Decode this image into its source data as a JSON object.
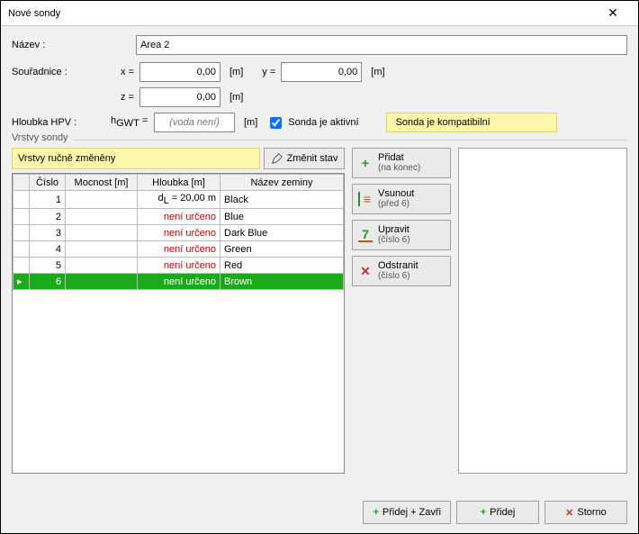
{
  "window": {
    "title": "Nové sondy"
  },
  "form": {
    "name_label": "Název :",
    "name_value": "Area 2",
    "coord_label": "Souřadnice :",
    "x_label": "x =",
    "x_value": "0,00",
    "x_unit": "[m]",
    "y_label": "y =",
    "y_value": "0,00",
    "y_unit": "[m]",
    "z_label": "z =",
    "z_value": "0,00",
    "z_unit": "[m]",
    "depth_label": "Hloubka HPV :",
    "depth_sym": "hGWT =",
    "depth_placeholder": "(voda není)",
    "depth_unit": "[m]",
    "active_label": "Sonda je aktivní",
    "compat_text": "Sonda je kompatibilní"
  },
  "layers": {
    "legend": "Vrstvy sondy",
    "status": "Vrstvy ručně změněny",
    "change_btn": "Změnit stav",
    "headers": {
      "col0": "",
      "num": "Číslo",
      "thick": "Mocnost [m]",
      "depth": "Hloubka [m]",
      "soil": "Název zeminy"
    },
    "dl_label": "dL = 20,00 m",
    "rows": [
      {
        "num": "1",
        "thick": "",
        "depth_kind": "dl",
        "soil": "Black"
      },
      {
        "num": "2",
        "thick": "",
        "depth_kind": "none",
        "soil": "Blue"
      },
      {
        "num": "3",
        "thick": "",
        "depth_kind": "none",
        "soil": "Dark Blue"
      },
      {
        "num": "4",
        "thick": "",
        "depth_kind": "none",
        "soil": "Green"
      },
      {
        "num": "5",
        "thick": "",
        "depth_kind": "none",
        "soil": "Red"
      },
      {
        "num": "6",
        "thick": "",
        "depth_kind": "none",
        "soil": "Brown",
        "selected": true
      }
    ],
    "not_determined": "není určeno",
    "actions": {
      "add": {
        "t1": "Přidat",
        "t2": "(na konec)"
      },
      "insert": {
        "t1": "Vsunout",
        "t2": "(před 6)"
      },
      "edit": {
        "t1": "Upravit",
        "t2": "(číslo 6)"
      },
      "remove": {
        "t1": "Odstranit",
        "t2": "(číslo 6)"
      }
    }
  },
  "footer": {
    "add_close": "Přidej + Zavři",
    "add": "Přidej",
    "cancel": "Storno"
  }
}
